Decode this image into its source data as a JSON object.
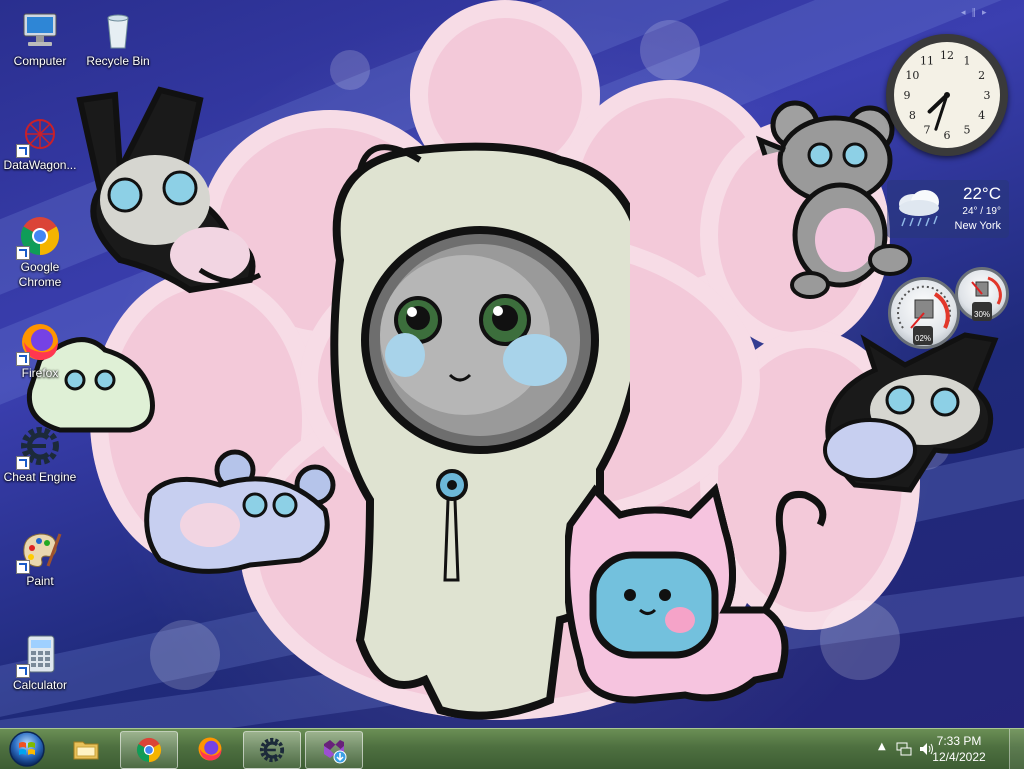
{
  "desktop": {
    "icons": [
      {
        "label": "Computer",
        "icon": "computer-icon",
        "shortcut": false
      },
      {
        "label": "Recycle Bin",
        "icon": "recycle-bin-icon",
        "shortcut": false
      },
      {
        "label": "DataWagon...",
        "icon": "datawagon-icon",
        "shortcut": true
      },
      {
        "label": "Google Chrome",
        "icon": "chrome-icon",
        "shortcut": true
      },
      {
        "label": "Firefox",
        "icon": "firefox-icon",
        "shortcut": true
      },
      {
        "label": "Cheat Engine",
        "icon": "cheat-engine-icon",
        "shortcut": true
      },
      {
        "label": "Paint",
        "icon": "paint-icon",
        "shortcut": true
      },
      {
        "label": "Calculator",
        "icon": "calculator-icon",
        "shortcut": true
      }
    ]
  },
  "gadgets": {
    "clock": {
      "hour": 7,
      "minute": 33,
      "numerals": [
        "12",
        "1",
        "2",
        "3",
        "4",
        "5",
        "6",
        "7",
        "8",
        "9",
        "10",
        "11"
      ]
    },
    "weather": {
      "temp": "22°C",
      "range": "24° / 19°",
      "city": "New York",
      "icon": "rain-cloud-icon"
    },
    "cpu_meter": {
      "cpu": "02%",
      "memory": "30%"
    }
  },
  "taskbar": {
    "start_icon": "windows-start-icon",
    "buttons": [
      {
        "name": "file-explorer",
        "icon": "folder-icon",
        "active": false
      },
      {
        "name": "chrome",
        "icon": "chrome-icon",
        "active": true
      },
      {
        "name": "firefox",
        "icon": "firefox-icon",
        "active": false
      },
      {
        "name": "cheat-engine",
        "icon": "cheat-engine-icon",
        "active": true
      },
      {
        "name": "visual-studio-installer",
        "icon": "vs-installer-icon",
        "active": true
      }
    ],
    "tray": {
      "time": "7:33 PM",
      "date": "12/4/2022",
      "icons": [
        "show-hidden-icons-arrow",
        "network-icon",
        "volume-icon"
      ]
    }
  },
  "colors": {
    "wallpaper_blue": "#2a2f8f",
    "cloud_pink": "#f3c9d9",
    "taskbar_green": "#4e7040"
  }
}
